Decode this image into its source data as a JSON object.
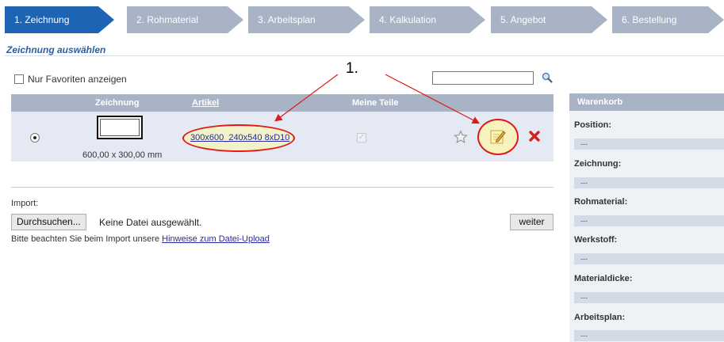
{
  "steps": [
    {
      "label": "1. Zeichnung",
      "active": true
    },
    {
      "label": "2. Rohmaterial",
      "active": false
    },
    {
      "label": "3. Arbeitsplan",
      "active": false
    },
    {
      "label": "4. Kalkulation",
      "active": false
    },
    {
      "label": "5. Angebot",
      "active": false
    },
    {
      "label": "6. Bestellung",
      "active": false
    }
  ],
  "section_title": "Zeichnung auswählen",
  "favorites_label": "Nur Favoriten anzeigen",
  "callout": "1.",
  "search": {
    "value": ""
  },
  "table": {
    "headers": {
      "zeichnung": "Zeichnung",
      "artikel": "Artikel",
      "meine_teile": "Meine Teile"
    },
    "row": {
      "dimensions": "600,00 x 300,00 mm",
      "artikel": "300x600_240x540 8xD10",
      "selected": true,
      "meine_teile_checked": true
    }
  },
  "import": {
    "label": "Import:",
    "browse_label": "Durchsuchen...",
    "file_status": "Keine Datei ausgewählt.",
    "weiter_label": "weiter",
    "note_prefix": "Bitte beachten Sie beim Import unsere",
    "note_link": "Hinweise zum Datei-Upload"
  },
  "cart": {
    "title": "Warenkorb",
    "fields": [
      {
        "label": "Position:",
        "value": "---"
      },
      {
        "label": "Zeichnung:",
        "value": "---"
      },
      {
        "label": "Rohmaterial:",
        "value": "---"
      },
      {
        "label": "Werkstoff:",
        "value": "---"
      },
      {
        "label": "Materialdicke:",
        "value": "---"
      },
      {
        "label": "Arbeitsplan:",
        "value": "---"
      }
    ]
  },
  "colors": {
    "accent": "#1e64b4",
    "inactive_step": "#a8b3c6",
    "annotation": "#e01818"
  },
  "icons": [
    "search-icon",
    "star-icon",
    "edit-icon",
    "delete-icon"
  ]
}
